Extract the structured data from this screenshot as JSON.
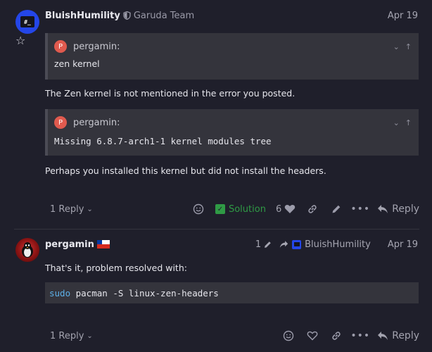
{
  "post1": {
    "username": "BluishHumility",
    "user_title": "Garuda Team",
    "date": "Apr 19",
    "avatar_text": "#_",
    "quote1": {
      "avatar_letter": "P",
      "author": "pergamin:",
      "text": "zen kernel"
    },
    "paragraph1": "The Zen kernel is not mentioned in the error you posted.",
    "quote2": {
      "avatar_letter": "P",
      "author": "pergamin:",
      "text": "Missing 6.8.7-arch1-1 kernel modules tree"
    },
    "paragraph2": "Perhaps you installed this kernel but did not install the headers.",
    "actions": {
      "replies_label": "1 Reply",
      "solution_label": "Solution",
      "like_count": "6",
      "reply_label": "Reply"
    }
  },
  "post2": {
    "username": "pergamin",
    "date": "Apr 19",
    "edit_count": "1",
    "reply_to_user": "BluishHumility",
    "paragraph": "That's it, problem resolved with:",
    "code": {
      "keyword": "sudo",
      "rest": " pacman -S linux-zen-headers"
    },
    "actions": {
      "replies_label": "1 Reply",
      "reply_label": "Reply"
    }
  }
}
